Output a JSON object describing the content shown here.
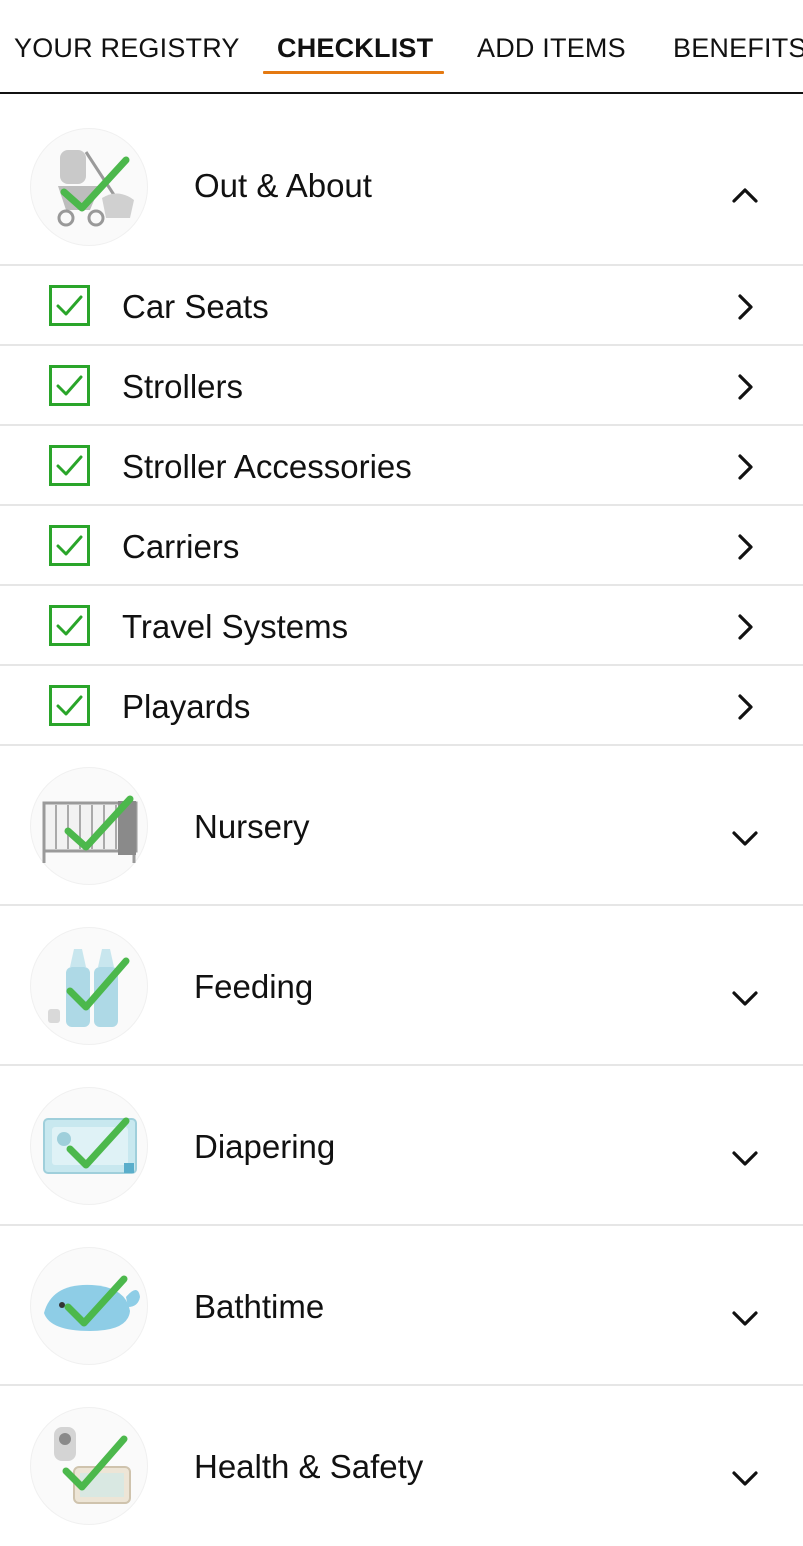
{
  "tabs": [
    {
      "label": "YOUR REGISTRY",
      "active": false
    },
    {
      "label": "CHECKLIST",
      "active": true
    },
    {
      "label": "ADD ITEMS",
      "active": false
    },
    {
      "label": "BENEFITS",
      "active": false
    }
  ],
  "colors": {
    "accent_underline": "#e47911",
    "check_green": "#2aa52a",
    "divider": "#e6e6e6",
    "thumb_check": "#4cb84c"
  },
  "categories": [
    {
      "label": "Out & About",
      "icon": "stroller-thumbnail",
      "expanded": true,
      "subcategories": [
        {
          "label": "Car Seats",
          "checked": true
        },
        {
          "label": "Strollers",
          "checked": true
        },
        {
          "label": "Stroller Accessories",
          "checked": true
        },
        {
          "label": "Carriers",
          "checked": true
        },
        {
          "label": "Travel Systems",
          "checked": true
        },
        {
          "label": "Playards",
          "checked": true
        }
      ]
    },
    {
      "label": "Nursery",
      "icon": "crib-thumbnail",
      "expanded": false
    },
    {
      "label": "Feeding",
      "icon": "bottles-thumbnail",
      "expanded": false
    },
    {
      "label": "Diapering",
      "icon": "wipes-thumbnail",
      "expanded": false
    },
    {
      "label": "Bathtime",
      "icon": "whale-tub-thumbnail",
      "expanded": false
    },
    {
      "label": "Health & Safety",
      "icon": "baby-monitor-thumbnail",
      "expanded": false
    }
  ]
}
